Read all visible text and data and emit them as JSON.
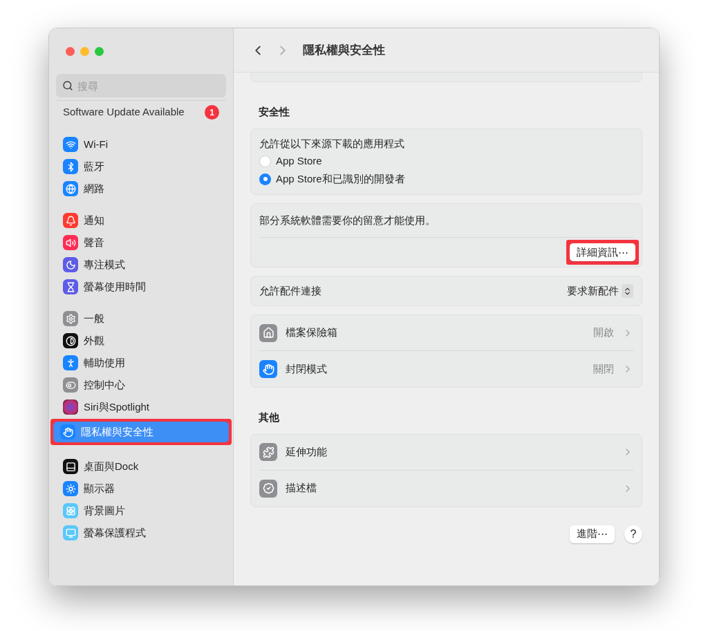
{
  "toolbar": {
    "title": "隱私權與安全性"
  },
  "sidebar": {
    "search": {
      "placeholder": "搜尋"
    },
    "update": {
      "label": "Software Update Available",
      "badge": "1"
    },
    "groups": [
      [
        {
          "label": "Wi-Fi",
          "kind": "wifi",
          "selected": false,
          "annotated": false
        },
        {
          "label": "藍牙",
          "kind": "bluetooth",
          "selected": false,
          "annotated": false
        },
        {
          "label": "網路",
          "kind": "globe",
          "selected": false,
          "annotated": false
        }
      ],
      [
        {
          "label": "通知",
          "kind": "bell",
          "selected": false,
          "annotated": false
        },
        {
          "label": "聲音",
          "kind": "sound",
          "selected": false,
          "annotated": false
        },
        {
          "label": "專注模式",
          "kind": "moon",
          "selected": false,
          "annotated": false
        },
        {
          "label": "螢幕使用時間",
          "kind": "hourglass",
          "selected": false,
          "annotated": false
        }
      ],
      [
        {
          "label": "一般",
          "kind": "gear",
          "selected": false,
          "annotated": false
        },
        {
          "label": "外觀",
          "kind": "contrast",
          "selected": false,
          "annotated": false
        },
        {
          "label": "輔助使用",
          "kind": "accessibility",
          "selected": false,
          "annotated": false
        },
        {
          "label": "控制中心",
          "kind": "toggles",
          "selected": false,
          "annotated": false
        },
        {
          "label": "Siri與Spotlight",
          "kind": "siri",
          "selected": false,
          "annotated": false
        },
        {
          "label": "隱私權與安全性",
          "kind": "hand",
          "selected": true,
          "annotated": true
        }
      ],
      [
        {
          "label": "桌面與Dock",
          "kind": "dock",
          "selected": false,
          "annotated": false
        },
        {
          "label": "顯示器",
          "kind": "sun",
          "selected": false,
          "annotated": false
        },
        {
          "label": "背景圖片",
          "kind": "flower",
          "selected": false,
          "annotated": false
        },
        {
          "label": "螢幕保護程式",
          "kind": "screen",
          "selected": false,
          "annotated": false
        }
      ]
    ]
  },
  "sections": [
    {
      "heading": "安全性",
      "cards": [
        {
          "kind": "radio_group",
          "title": "允許從以下來源下載的應用程式",
          "options": [
            {
              "label": "App Store",
              "selected": false
            },
            {
              "label": "App Store和已識別的開發者",
              "selected": true
            }
          ]
        },
        {
          "kind": "notice",
          "text": "部分系統軟體需要你的留意才能使用。",
          "button": {
            "label": "詳細資訊⋯",
            "annotated": true
          }
        },
        {
          "kind": "popup",
          "label": "允許配件連接",
          "value": "要求新配件"
        },
        {
          "kind": "links",
          "rows": [
            {
              "kind": "house",
              "label": "檔案保險箱",
              "value": "開啟"
            },
            {
              "kind": "hand",
              "label": "封閉模式",
              "value": "關閉"
            }
          ]
        }
      ]
    },
    {
      "heading": "其他",
      "cards": [
        {
          "kind": "links",
          "rows": [
            {
              "kind": "puzzle",
              "label": "延伸功能"
            },
            {
              "kind": "badge",
              "label": "描述檔"
            }
          ]
        }
      ]
    }
  ],
  "footer": {
    "button": "進階⋯",
    "help": "?"
  }
}
